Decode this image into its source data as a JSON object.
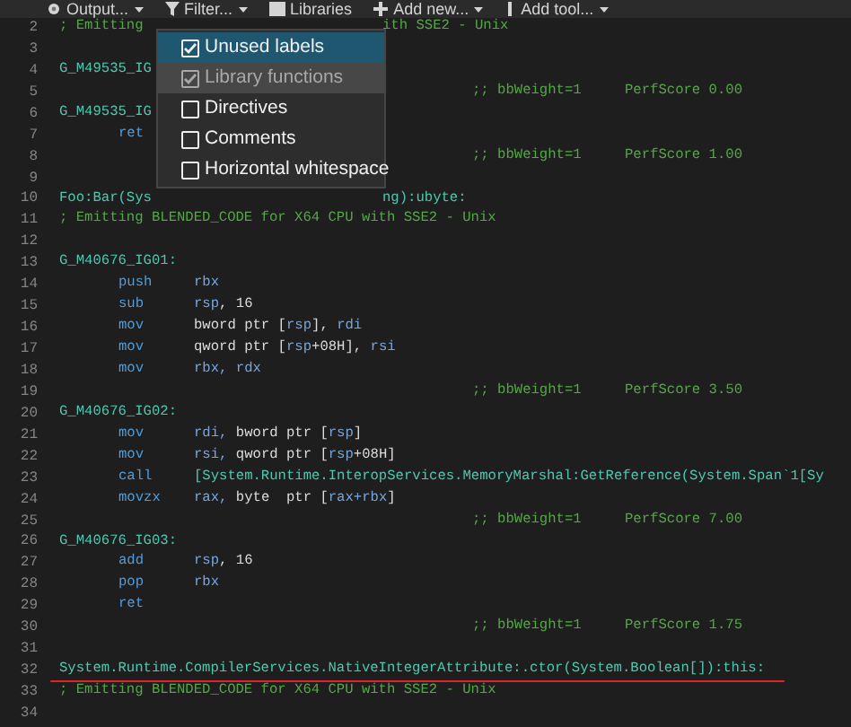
{
  "toolbar": [
    {
      "label": "Output...",
      "caret": true
    },
    {
      "label": "Filter...",
      "caret": true
    },
    {
      "label": "Libraries",
      "caret": false
    },
    {
      "label": "Add new...",
      "caret": true
    },
    {
      "label": "Add tool...",
      "caret": true
    }
  ],
  "filter_menu": {
    "items": [
      {
        "label": "Unused labels",
        "checked": true,
        "selected": true,
        "disabled": false
      },
      {
        "label": "Library functions",
        "checked": true,
        "selected": false,
        "disabled": true
      },
      {
        "label": "Directives",
        "checked": false,
        "selected": false,
        "disabled": false
      },
      {
        "label": "Comments",
        "checked": false,
        "selected": false,
        "disabled": false
      },
      {
        "label": "Horizontal whitespace",
        "checked": false,
        "selected": false,
        "disabled": false
      }
    ]
  },
  "lines": [
    {
      "n": "2",
      "kind": "covered_comment",
      "text": "; Emitting",
      "after_menu": "ith SSE2 - Unix"
    },
    {
      "n": "3",
      "kind": "blank"
    },
    {
      "n": "4",
      "kind": "label",
      "text": "G_M49535_IG"
    },
    {
      "n": "5",
      "kind": "score",
      "weight": ";; bbWeight=1",
      "score": "PerfScore 0.00"
    },
    {
      "n": "6",
      "kind": "label",
      "text": "G_M49535_IG"
    },
    {
      "n": "7",
      "kind": "instr",
      "op": "ret"
    },
    {
      "n": "8",
      "kind": "score",
      "weight": ";; bbWeight=1",
      "score": "PerfScore 1.00"
    },
    {
      "n": "9",
      "kind": "blank"
    },
    {
      "n": "10",
      "kind": "covered_label",
      "text": "Foo:Bar(Sys",
      "after_menu": "ng):ubyte:"
    },
    {
      "n": "11",
      "kind": "comment",
      "text": "; Emitting BLENDED_CODE for X64 CPU with SSE2 - Unix"
    },
    {
      "n": "12",
      "kind": "blank"
    },
    {
      "n": "13",
      "kind": "label",
      "text": "G_M40676_IG01:"
    },
    {
      "n": "14",
      "kind": "instr",
      "op": "push",
      "args": [
        {
          "text": "rbx",
          "kind": "reg"
        }
      ]
    },
    {
      "n": "15",
      "kind": "instr",
      "op": "sub",
      "args": [
        {
          "text": "rsp",
          "kind": "reg"
        },
        {
          "text": ", 16",
          "kind": "plain"
        }
      ]
    },
    {
      "n": "16",
      "kind": "instr",
      "op": "mov",
      "args": [
        {
          "text": "bword ptr [",
          "kind": "plain"
        },
        {
          "text": "rsp",
          "kind": "reg"
        },
        {
          "text": "], ",
          "kind": "plain"
        },
        {
          "text": "rdi",
          "kind": "reg"
        }
      ]
    },
    {
      "n": "17",
      "kind": "instr",
      "op": "mov",
      "args": [
        {
          "text": "qword ptr [",
          "kind": "plain"
        },
        {
          "text": "rsp",
          "kind": "reg"
        },
        {
          "text": "+08H], ",
          "kind": "plain"
        },
        {
          "text": "rsi",
          "kind": "reg"
        }
      ]
    },
    {
      "n": "18",
      "kind": "instr",
      "op": "mov",
      "args": [
        {
          "text": "rbx, rdx",
          "kind": "reg"
        }
      ]
    },
    {
      "n": "19",
      "kind": "score",
      "weight": ";; bbWeight=1",
      "score": "PerfScore 3.50"
    },
    {
      "n": "20",
      "kind": "label",
      "text": "G_M40676_IG02:"
    },
    {
      "n": "21",
      "kind": "instr",
      "op": "mov",
      "args": [
        {
          "text": "rdi, ",
          "kind": "reg"
        },
        {
          "text": "bword ptr [",
          "kind": "plain"
        },
        {
          "text": "rsp",
          "kind": "reg"
        },
        {
          "text": "]",
          "kind": "plain"
        }
      ]
    },
    {
      "n": "22",
      "kind": "instr",
      "op": "mov",
      "args": [
        {
          "text": "rsi, ",
          "kind": "reg"
        },
        {
          "text": "qword ptr [",
          "kind": "plain"
        },
        {
          "text": "rsp",
          "kind": "reg"
        },
        {
          "text": "+08H]",
          "kind": "plain"
        }
      ]
    },
    {
      "n": "23",
      "kind": "instr",
      "op": "call",
      "args": [
        {
          "text": "[System.Runtime.InteropServices.MemoryMarshal:GetReference(System.Span`1[Sy",
          "kind": "name"
        }
      ]
    },
    {
      "n": "24",
      "kind": "instr",
      "op": "movzx",
      "args": [
        {
          "text": "rax, ",
          "kind": "reg"
        },
        {
          "text": "byte  ptr [",
          "kind": "plain"
        },
        {
          "text": "rax+rbx",
          "kind": "reg"
        },
        {
          "text": "]",
          "kind": "plain"
        }
      ]
    },
    {
      "n": "25",
      "kind": "score",
      "weight": ";; bbWeight=1",
      "score": "PerfScore 7.00"
    },
    {
      "n": "26",
      "kind": "label",
      "text": "G_M40676_IG03:"
    },
    {
      "n": "27",
      "kind": "instr",
      "op": "add",
      "args": [
        {
          "text": "rsp",
          "kind": "reg"
        },
        {
          "text": ", 16",
          "kind": "plain"
        }
      ]
    },
    {
      "n": "28",
      "kind": "instr",
      "op": "pop",
      "args": [
        {
          "text": "rbx",
          "kind": "reg"
        }
      ]
    },
    {
      "n": "29",
      "kind": "instr",
      "op": "ret"
    },
    {
      "n": "30",
      "kind": "score",
      "weight": ";; bbWeight=1",
      "score": "PerfScore 1.75"
    },
    {
      "n": "31",
      "kind": "blank"
    },
    {
      "n": "32",
      "kind": "label",
      "text": "System.Runtime.CompilerServices.NativeIntegerAttribute:.ctor(System.Boolean[]):this:",
      "underlined": true
    },
    {
      "n": "33",
      "kind": "comment",
      "text": "; Emitting BLENDED_CODE for X64 CPU with SSE2 - Unix"
    },
    {
      "n": "34",
      "kind": "blank"
    }
  ]
}
